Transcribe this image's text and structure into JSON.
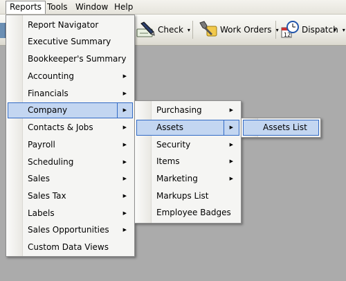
{
  "menubar": {
    "items": [
      {
        "label": "Reports"
      },
      {
        "label": "Tools"
      },
      {
        "label": "Window"
      },
      {
        "label": "Help"
      }
    ]
  },
  "toolbar": {
    "check_label": "Check",
    "work_orders_label": "Work Orders",
    "dispatch_label": "Dispatch",
    "caret": "▾",
    "more_caret": "▾"
  },
  "reports_menu": {
    "items": [
      {
        "label": "Report Navigator",
        "submenu": false
      },
      {
        "label": "Executive Summary",
        "submenu": false
      },
      {
        "label": "Bookkeeper's Summary",
        "submenu": false
      },
      {
        "label": "Accounting",
        "submenu": true
      },
      {
        "label": "Financials",
        "submenu": true
      },
      {
        "label": "Company",
        "submenu": true
      },
      {
        "label": "Contacts & Jobs",
        "submenu": true
      },
      {
        "label": "Payroll",
        "submenu": true
      },
      {
        "label": "Scheduling",
        "submenu": true
      },
      {
        "label": "Sales",
        "submenu": true
      },
      {
        "label": "Sales Tax",
        "submenu": true
      },
      {
        "label": "Labels",
        "submenu": true
      },
      {
        "label": "Sales Opportunities",
        "submenu": true
      },
      {
        "label": "Custom Data Views",
        "submenu": false
      }
    ]
  },
  "company_menu": {
    "items": [
      {
        "label": "Purchasing",
        "submenu": true
      },
      {
        "label": "Assets",
        "submenu": true
      },
      {
        "label": "Security",
        "submenu": true
      },
      {
        "label": "Items",
        "submenu": true
      },
      {
        "label": "Marketing",
        "submenu": true
      },
      {
        "label": "Markups List",
        "submenu": false
      },
      {
        "label": "Employee Badges",
        "submenu": false
      }
    ]
  },
  "assets_menu": {
    "items": [
      {
        "label": "Assets List"
      }
    ]
  },
  "arrow_glyph": "▶"
}
